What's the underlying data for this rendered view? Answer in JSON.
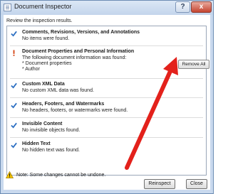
{
  "window": {
    "title": "Document Inspector",
    "help_label": "?",
    "close_glyph": "x"
  },
  "subtitle": "Review the inspection results.",
  "items": [
    {
      "heading": "Comments, Revisions, Versions, and Annotations",
      "description": [
        "No items were found."
      ],
      "status": "ok"
    },
    {
      "heading": "Document Properties and Personal Information",
      "description": [
        "The following document information was found:",
        "* Document properties",
        "* Author"
      ],
      "status": "found"
    },
    {
      "heading": "Custom XML Data",
      "description": [
        "No custom XML data was found."
      ],
      "status": "ok"
    },
    {
      "heading": "Headers, Footers, and Watermarks",
      "description": [
        "No headers, footers, or watermarks were found."
      ],
      "status": "ok"
    },
    {
      "heading": "Invisible Content",
      "description": [
        "No invisible objects found."
      ],
      "status": "ok"
    },
    {
      "heading": "Hidden Text",
      "description": [
        "No hidden text was found."
      ],
      "status": "ok"
    }
  ],
  "remove_all_label": "Remove All",
  "note": "Note: Some changes cannot be undone.",
  "buttons": {
    "reinspect": "Reinspect",
    "close": "Close"
  },
  "colors": {
    "ok_icon": "#2c6fc2",
    "found_icon": "#d4400f",
    "arrow": "#e3211b",
    "warning": "#f5c400"
  },
  "icons": {
    "ok": "checkmark-icon",
    "found": "exclamation-icon",
    "note": "warning-icon"
  }
}
